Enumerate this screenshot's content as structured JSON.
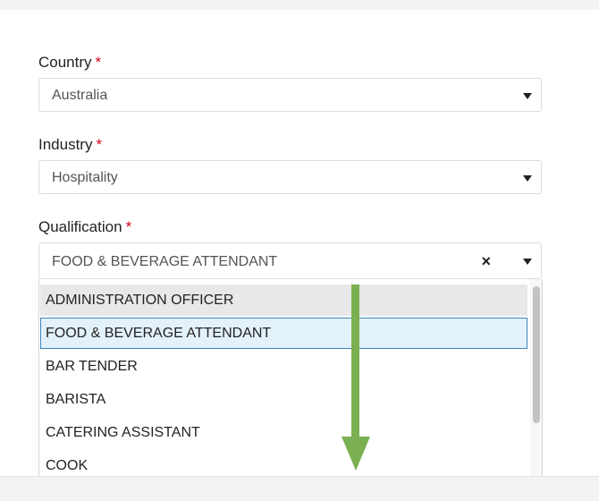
{
  "form": {
    "country": {
      "label": "Country",
      "required_mark": "*",
      "value": "Australia"
    },
    "industry": {
      "label": "Industry",
      "required_mark": "*",
      "value": "Hospitality"
    },
    "qualification": {
      "label": "Qualification",
      "required_mark": "*",
      "value": "FOOD & BEVERAGE ATTENDANT",
      "clear_symbol": "×",
      "options": [
        "ADMINISTRATION OFFICER",
        "FOOD & BEVERAGE ATTENDANT",
        "BAR TENDER",
        "BARISTA",
        "CATERING ASSISTANT",
        "COOK"
      ],
      "hovered_option": "ADMINISTRATION OFFICER",
      "selected_option": "FOOD & BEVERAGE ATTENDANT"
    }
  },
  "annotation": {
    "arrow_color": "#7ab051",
    "direction": "down"
  },
  "colors": {
    "required": "#d0021b",
    "selected_border": "#3c86b8",
    "selected_bg": "#e3f1fb",
    "hover_bg": "#e8e8e8"
  }
}
